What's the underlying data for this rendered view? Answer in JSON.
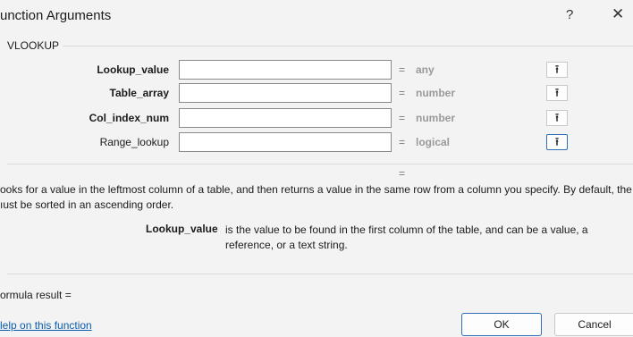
{
  "window": {
    "title": "unction Arguments",
    "help_label": "?",
    "close_label": "✕"
  },
  "function_name": "VLOOKUP",
  "arguments": [
    {
      "label": "Lookup_value",
      "value": "",
      "result_type": "any",
      "bold": true
    },
    {
      "label": "Table_array",
      "value": "",
      "result_type": "number",
      "bold": true
    },
    {
      "label": "Col_index_num",
      "value": "",
      "result_type": "number",
      "bold": true
    },
    {
      "label": "Range_lookup",
      "value": "",
      "result_type": "logical",
      "bold": false
    }
  ],
  "equals_sign": "=",
  "ref_icon": "collapse-dialog-arrow-icon",
  "ref_glyph": "⭱",
  "total_result": "=",
  "description_line1": "ooks for a value in the leftmost column of a table, and then returns a value in the same row from a column you specify. By default, the table",
  "description_line2": "ıust be sorted in an ascending order.",
  "arg_help": {
    "name": "Lookup_value",
    "text": "is the value to be found in the first column of the table, and can be a value, a reference, or a text string."
  },
  "formula_result_label": "ormula result =",
  "help_link": "lelp on this function",
  "buttons": {
    "ok": "OK",
    "cancel": "Cancel"
  }
}
